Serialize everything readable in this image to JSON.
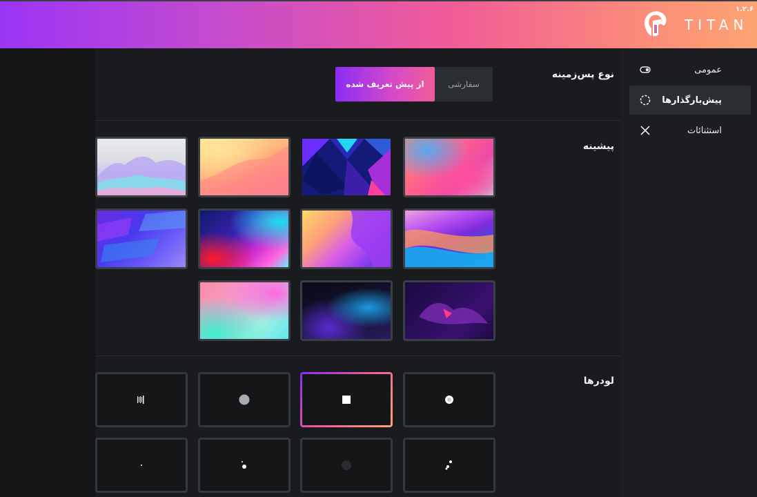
{
  "app": {
    "brand": "TITAN",
    "version": "۱.۲.۶"
  },
  "sidebar": {
    "items": [
      {
        "label": "عمومی",
        "icon": "toggle-icon",
        "active": false
      },
      {
        "label": "پیش‌بارگذارها",
        "icon": "circle-loader-icon",
        "active": true
      },
      {
        "label": "استثنائات",
        "icon": "close-icon",
        "active": false
      }
    ]
  },
  "background_type": {
    "label": "نوع پس‌زمینه",
    "options": [
      "از پیش تعریف شده",
      "سفارشی"
    ],
    "selected": "از پیش تعریف شده"
  },
  "presets": {
    "label": "پیشینه",
    "selected_index": 1,
    "count": 11
  },
  "loaders": {
    "label": "لودرها",
    "selected_index": 1,
    "count": 8
  },
  "colors": {
    "accent_start": "#8b2cf5",
    "accent_mid": "#f25c97",
    "accent_end": "#fda473",
    "panel_bg": "#191b1e"
  }
}
